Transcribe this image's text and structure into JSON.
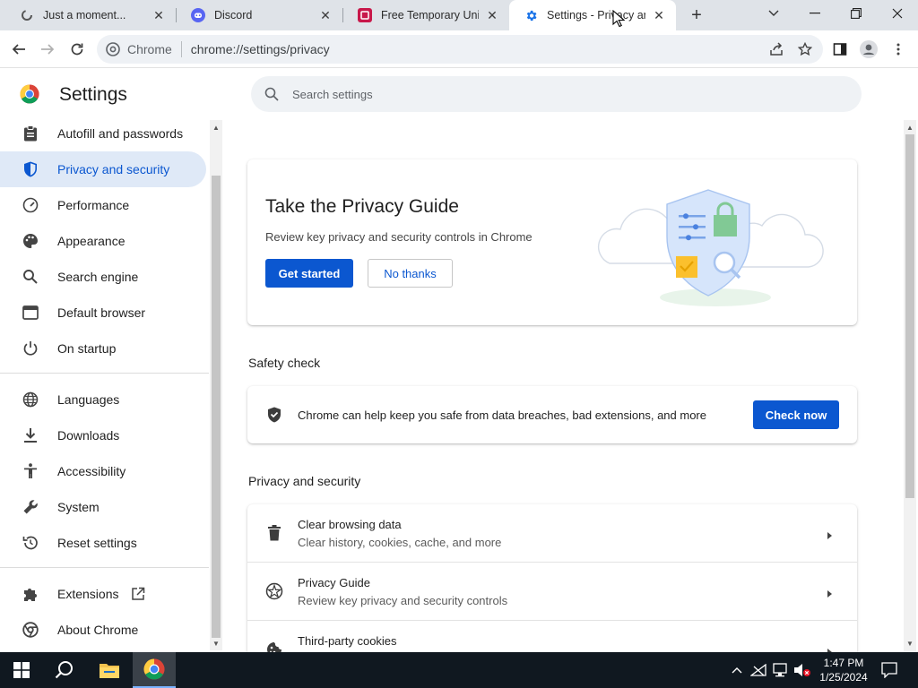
{
  "browser": {
    "tabs": [
      {
        "title": "Just a moment...",
        "favicon": "loading-icon"
      },
      {
        "title": "Discord",
        "favicon": "discord-icon"
      },
      {
        "title": "Free Temporary United",
        "favicon": "site-icon"
      },
      {
        "title": "Settings - Privacy and s",
        "favicon": "gear-icon",
        "active": true
      }
    ],
    "omnibox": {
      "scheme": "Chrome",
      "url": "chrome://settings/privacy"
    }
  },
  "settings": {
    "title": "Settings",
    "search_placeholder": "Search settings",
    "nav": [
      {
        "label": "Autofill and passwords",
        "icon": "clipboard-icon"
      },
      {
        "label": "Privacy and security",
        "icon": "shield-icon",
        "active": true
      },
      {
        "label": "Performance",
        "icon": "speedometer-icon"
      },
      {
        "label": "Appearance",
        "icon": "palette-icon"
      },
      {
        "label": "Search engine",
        "icon": "search-icon"
      },
      {
        "label": "Default browser",
        "icon": "browser-window-icon"
      },
      {
        "label": "On startup",
        "icon": "power-icon"
      },
      {
        "label": "Languages",
        "icon": "globe-icon"
      },
      {
        "label": "Downloads",
        "icon": "download-icon"
      },
      {
        "label": "Accessibility",
        "icon": "accessibility-icon"
      },
      {
        "label": "System",
        "icon": "wrench-icon"
      },
      {
        "label": "Reset settings",
        "icon": "reset-icon"
      },
      {
        "label": "Extensions",
        "icon": "puzzle-icon"
      },
      {
        "label": "About Chrome",
        "icon": "chrome-icon"
      }
    ],
    "privacy_guide": {
      "title": "Take the Privacy Guide",
      "description": "Review key privacy and security controls in Chrome",
      "primary_button": "Get started",
      "secondary_button": "No thanks"
    },
    "safety_check": {
      "section_title": "Safety check",
      "text": "Chrome can help keep you safe from data breaches, bad extensions, and more",
      "button": "Check now"
    },
    "privacy_section": {
      "section_title": "Privacy and security",
      "rows": [
        {
          "title": "Clear browsing data",
          "subtitle": "Clear history, cookies, cache, and more",
          "icon": "trash-icon"
        },
        {
          "title": "Privacy Guide",
          "subtitle": "Review key privacy and security controls",
          "icon": "privacy-guide-icon"
        },
        {
          "title": "Third-party cookies",
          "subtitle": "",
          "icon": "cookie-icon"
        }
      ]
    }
  },
  "taskbar": {
    "time": "1:47 PM",
    "date": "1/25/2024"
  },
  "colors": {
    "accent": "#0b57d0",
    "active_nav_bg": "#dfe9f7",
    "taskbar": "#101820"
  }
}
